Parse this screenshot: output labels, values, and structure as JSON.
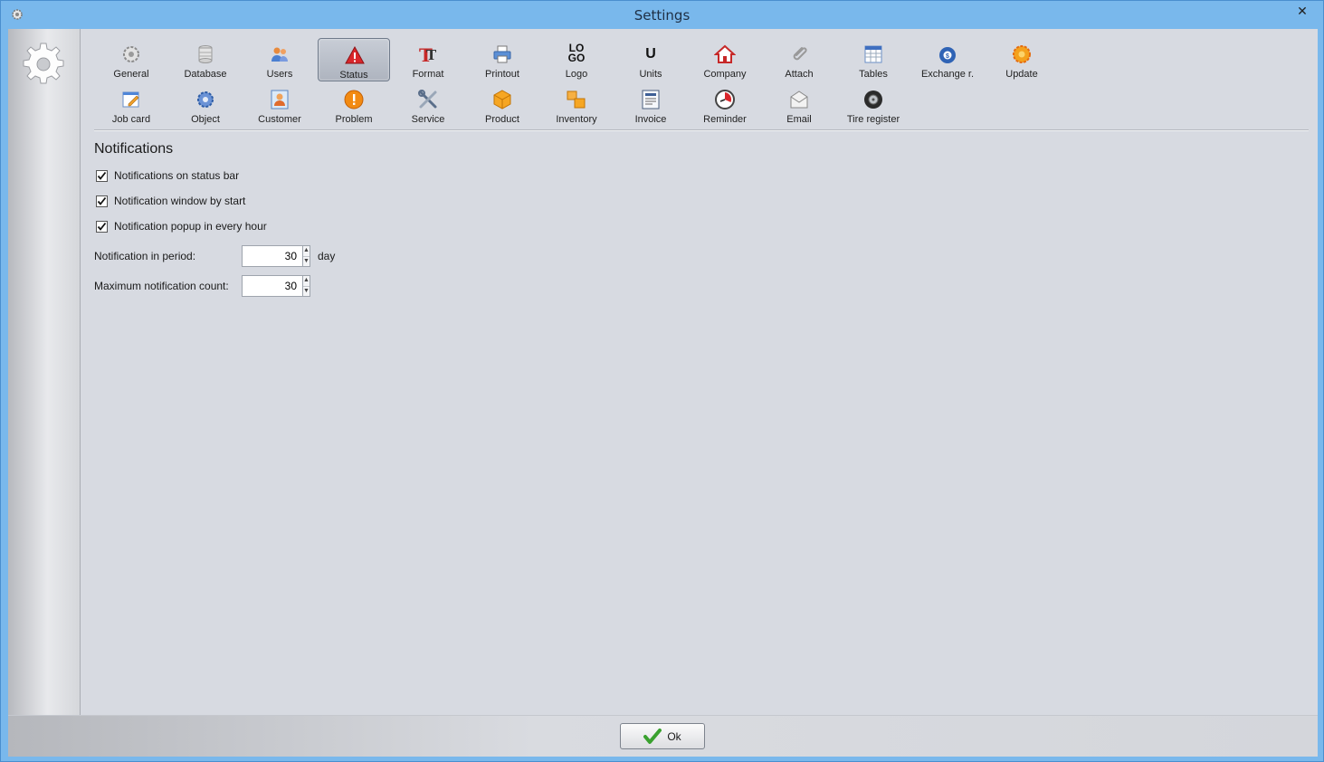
{
  "window": {
    "title": "Settings",
    "close_label": "✕"
  },
  "nav": {
    "row1": [
      {
        "label": "General",
        "icon": "gear-icon"
      },
      {
        "label": "Database",
        "icon": "database-icon"
      },
      {
        "label": "Users",
        "icon": "users-icon"
      },
      {
        "label": "Status",
        "icon": "warning-icon",
        "active": true
      },
      {
        "label": "Format",
        "icon": "format-icon"
      },
      {
        "label": "Printout",
        "icon": "printer-icon"
      },
      {
        "label": "Logo",
        "icon": "logo-icon"
      },
      {
        "label": "Units",
        "icon": "units-icon"
      },
      {
        "label": "Company",
        "icon": "house-icon"
      },
      {
        "label": "Attach",
        "icon": "paperclip-icon"
      },
      {
        "label": "Tables",
        "icon": "table-icon"
      },
      {
        "label": "Exchange r.",
        "icon": "exchange-icon"
      },
      {
        "label": "Update",
        "icon": "update-icon"
      }
    ],
    "row2": [
      {
        "label": "Job card",
        "icon": "job-card-icon"
      },
      {
        "label": "Object",
        "icon": "object-gear-icon"
      },
      {
        "label": "Customer",
        "icon": "customer-icon"
      },
      {
        "label": "Problem",
        "icon": "problem-icon"
      },
      {
        "label": "Service",
        "icon": "tools-icon"
      },
      {
        "label": "Product",
        "icon": "box-icon"
      },
      {
        "label": "Inventory",
        "icon": "boxes-icon"
      },
      {
        "label": "Invoice",
        "icon": "invoice-icon"
      },
      {
        "label": "Reminder",
        "icon": "clock-icon"
      },
      {
        "label": "Email",
        "icon": "envelope-icon"
      },
      {
        "label": "Tire register",
        "icon": "tire-icon"
      }
    ],
    "logo_text_top": "LO",
    "logo_text_bottom": "GO",
    "units_text": "U"
  },
  "notifications": {
    "title": "Notifications",
    "checks": [
      {
        "label": "Notifications on status bar",
        "checked": true
      },
      {
        "label": "Notification window by start",
        "checked": true
      },
      {
        "label": "Notification popup in every hour",
        "checked": true
      }
    ],
    "period": {
      "label": "Notification in period:",
      "value": "30",
      "unit": "day"
    },
    "max_count": {
      "label": "Maximum notification count:",
      "value": "30"
    }
  },
  "footer": {
    "ok_label": "Ok"
  },
  "colors": {
    "titlebar": "#79b8ec",
    "client": "#d7dae1",
    "accent_red": "#d9262b",
    "ok_green": "#3aa12f"
  }
}
